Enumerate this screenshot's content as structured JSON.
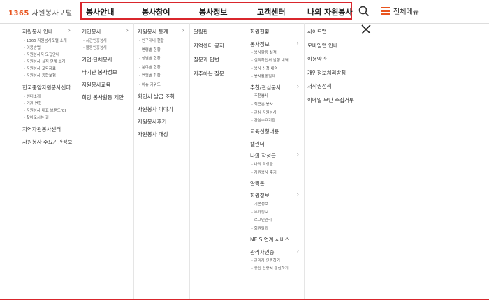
{
  "logo": {
    "num": "1365",
    "text": "자원봉사포털"
  },
  "nav": [
    "봉사안내",
    "봉사참여",
    "봉사정보",
    "고객센터",
    "나의 자원봉사"
  ],
  "full_menu_label": "전체메뉴",
  "cols": [
    [
      {
        "t": "자원봉사 안내",
        "l": 1,
        "chev": true
      },
      {
        "t": "1365 자원봉사포털 소개",
        "l": 2
      },
      {
        "t": "이용방법",
        "l": 2
      },
      {
        "t": "자원봉사자 모집안내",
        "l": 2
      },
      {
        "t": "자원봉사 실적 연계 소개",
        "l": 2
      },
      {
        "t": "자원봉사 교육자료",
        "l": 2
      },
      {
        "t": "자원봉사 종합보험",
        "l": 2
      },
      {
        "t": "한국중앙자원봉사센터",
        "l": 1,
        "chev": true
      },
      {
        "t": "센터소개",
        "l": 2
      },
      {
        "t": "기관 연혁",
        "l": 2
      },
      {
        "t": "자원봉사 대표 브랜드/CI",
        "l": 2
      },
      {
        "t": "찾아오시는 길",
        "l": 2
      },
      {
        "t": "지역자원봉사센터",
        "l": 1
      },
      {
        "t": "자원봉사 수요기관정보",
        "l": 1
      }
    ],
    [
      {
        "t": "개인봉사",
        "l": 1,
        "chev": true
      },
      {
        "t": "시간인증봉사",
        "l": 2
      },
      {
        "t": "활동인증봉사",
        "l": 2
      },
      {
        "t": "기업·단체봉사",
        "l": 1
      },
      {
        "t": "타기관 봉사정보",
        "l": 1
      },
      {
        "t": "자원봉사교육",
        "l": 1
      },
      {
        "t": "희망 봉사활동 제안",
        "l": 1
      }
    ],
    [
      {
        "t": "자원봉사 통계",
        "l": 1,
        "chev": true
      },
      {
        "t": "인구대비 현황",
        "l": 2
      },
      {
        "t": "연령별 현황",
        "l": 2
      },
      {
        "t": "성별별 현황",
        "l": 2
      },
      {
        "t": "분야별 현황",
        "l": 2
      },
      {
        "t": "연령별 현황",
        "l": 2
      },
      {
        "t": "이슈 키워드",
        "l": 2
      },
      {
        "t": "확인서 발급 조회",
        "l": 1
      },
      {
        "t": "자원봉사 이야기",
        "l": 1
      },
      {
        "t": "자원봉사후기",
        "l": 1
      },
      {
        "t": "자원봉사 대상",
        "l": 1
      }
    ],
    [
      {
        "t": "알림판",
        "l": 1
      },
      {
        "t": "지역센터 공지",
        "l": 1
      },
      {
        "t": "질문과 답변",
        "l": 1
      },
      {
        "t": "자주하는 질문",
        "l": 1
      }
    ],
    [
      {
        "t": "회원현황",
        "l": 1
      },
      {
        "t": "봉사정보",
        "l": 1,
        "chev": true
      },
      {
        "t": "봉사활동 실적",
        "l": 2
      },
      {
        "t": "실적확인서 발행 내역",
        "l": 2
      },
      {
        "t": "봉사 신청 내역",
        "l": 2
      },
      {
        "t": "봉사활동일계",
        "l": 2
      },
      {
        "t": "추천/관심봉사",
        "l": 1,
        "chev": true
      },
      {
        "t": "추천봉사",
        "l": 2
      },
      {
        "t": "최근본 봉사",
        "l": 2
      },
      {
        "t": "관심 자원봉사",
        "l": 2
      },
      {
        "t": "관심수요기관",
        "l": 2
      },
      {
        "t": "교육신청내용",
        "l": 1
      },
      {
        "t": "캘린더",
        "l": 1
      },
      {
        "t": "나의 작성글",
        "l": 1,
        "chev": true
      },
      {
        "t": "나의 작성글",
        "l": 2
      },
      {
        "t": "자원봉사 후기",
        "l": 2
      },
      {
        "t": "알림톡",
        "l": 1
      },
      {
        "t": "회원정보",
        "l": 1,
        "chev": true
      },
      {
        "t": "기본정보",
        "l": 2
      },
      {
        "t": "부가정보",
        "l": 2
      },
      {
        "t": "로그인관리",
        "l": 2
      },
      {
        "t": "회원탈퇴",
        "l": 2
      },
      {
        "t": "NEIS 연계 서비스",
        "l": 1
      },
      {
        "t": "관리자인증",
        "l": 1,
        "chev": true
      },
      {
        "t": "관리자 인증하기",
        "l": 2
      },
      {
        "t": "공인 인증서 갱신하기",
        "l": 2
      }
    ],
    [
      {
        "t": "사이트맵",
        "l": 1
      },
      {
        "t": "모바일앱 안내",
        "l": 1
      },
      {
        "t": "이용약관",
        "l": 1
      },
      {
        "t": "개인정보처리방침",
        "l": 1
      },
      {
        "t": "저작권정책",
        "l": 1
      },
      {
        "t": "이메일 무단 수집거부",
        "l": 1
      }
    ]
  ]
}
